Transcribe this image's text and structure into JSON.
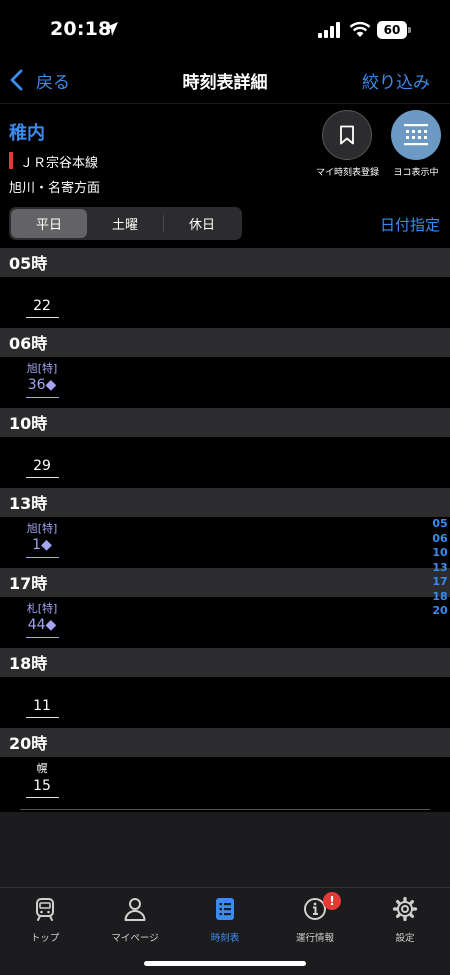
{
  "status_bar": {
    "time": "20:18",
    "battery": "60"
  },
  "nav": {
    "back_label": "戻る",
    "title": "時刻表詳細",
    "filter_label": "絞り込み"
  },
  "station": {
    "name": "稚内",
    "line": "ＪＲ宗谷本線",
    "line_color": "#e53935",
    "direction": "旭川・名寄方面"
  },
  "actions": {
    "my_timetable": {
      "label": "マイ時刻表登録",
      "icon": "bookmark-icon"
    },
    "horizontal": {
      "label": "ヨコ表示中",
      "icon": "grid-icon"
    }
  },
  "day_tabs": [
    {
      "label": "平日",
      "selected": true
    },
    {
      "label": "土曜",
      "selected": false
    },
    {
      "label": "休日",
      "selected": false
    }
  ],
  "date_button": "日付指定",
  "hours": [
    {
      "hour": "05時",
      "trains": [
        {
          "type": "",
          "minute": "22"
        }
      ]
    },
    {
      "hour": "06時",
      "trains": [
        {
          "type": "旭[特]",
          "minute": "36◆"
        }
      ]
    },
    {
      "hour": "10時",
      "trains": [
        {
          "type": "",
          "minute": "29"
        }
      ]
    },
    {
      "hour": "13時",
      "trains": [
        {
          "type": "旭[特]",
          "minute": "1◆"
        }
      ]
    },
    {
      "hour": "17時",
      "trains": [
        {
          "type": "札[特]",
          "minute": "44◆"
        }
      ]
    },
    {
      "hour": "18時",
      "trains": [
        {
          "type": "",
          "minute": "11"
        }
      ]
    },
    {
      "hour": "20時",
      "trains": [
        {
          "type": "幌",
          "minute": "15"
        }
      ]
    }
  ],
  "hour_index": [
    "05",
    "06",
    "10",
    "13",
    "17",
    "18",
    "20"
  ],
  "colors": {
    "accent": "#3b8cf0",
    "special_train": "#a4a4f3",
    "badge": "#e53935"
  },
  "tabbar": {
    "items": [
      {
        "label": "トップ",
        "icon": "train-icon",
        "active": false
      },
      {
        "label": "マイページ",
        "icon": "person-icon",
        "active": false
      },
      {
        "label": "時刻表",
        "icon": "timetable-icon",
        "active": true
      },
      {
        "label": "運行情報",
        "icon": "info-icon",
        "active": false,
        "badge": "!"
      },
      {
        "label": "設定",
        "icon": "gear-icon",
        "active": false
      }
    ]
  }
}
